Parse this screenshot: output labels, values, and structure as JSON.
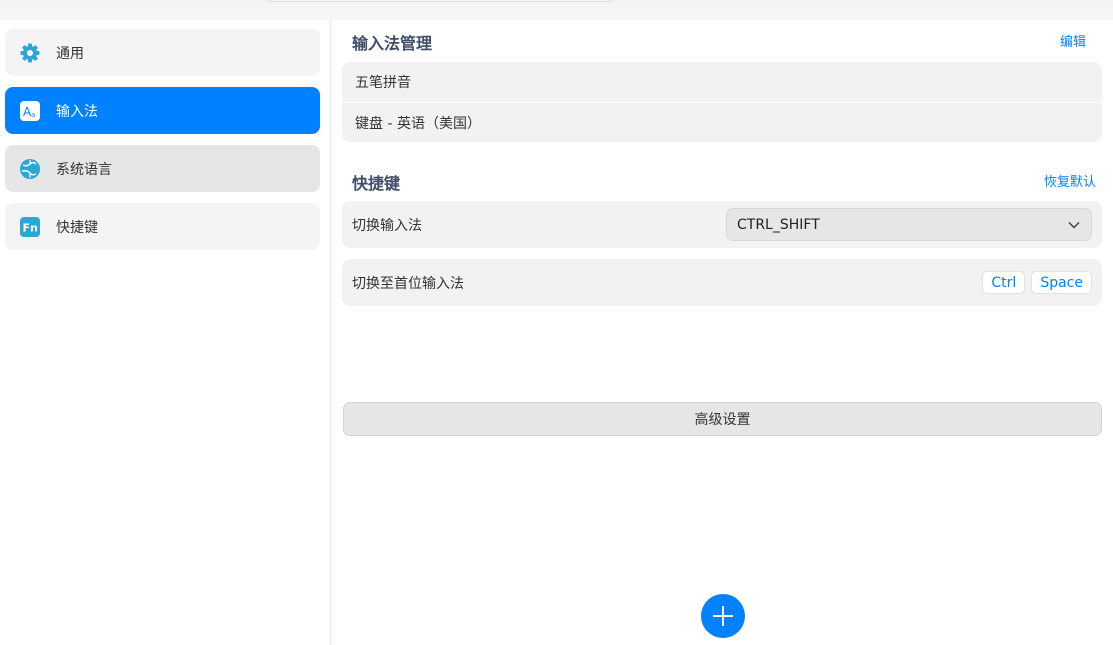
{
  "sidebar": {
    "items": [
      {
        "label": "通用",
        "icon": "gear-icon"
      },
      {
        "label": "输入法",
        "icon": "input-method-icon"
      },
      {
        "label": "系统语言",
        "icon": "globe-icon"
      },
      {
        "label": "快捷键",
        "icon": "fn-key-icon"
      }
    ]
  },
  "input_methods": {
    "title": "输入法管理",
    "edit_label": "编辑",
    "items": [
      "五笔拼音",
      "键盘 - 英语（美国）"
    ]
  },
  "shortcuts": {
    "title": "快捷键",
    "restore_label": "恢复默认",
    "switch_label": "切换输入法",
    "switch_value": "CTRL_SHIFT",
    "first_label": "切换至首位输入法",
    "first_keys": [
      "Ctrl",
      "Space"
    ]
  },
  "advanced_label": "高级设置",
  "colors": {
    "accent": "#0081ff",
    "sidebar_active_bg": "#0081ff",
    "row_bg": "#f2f2f2"
  }
}
